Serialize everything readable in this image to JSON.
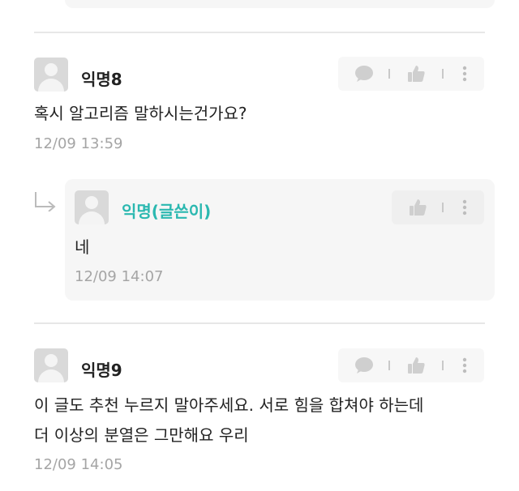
{
  "comments": [
    {
      "author": "익명8",
      "text": "혹시 알고리즘 말하시는건가요?",
      "time": "12/09 13:59"
    },
    {
      "author": "익명9",
      "text_line1": "이 글도 추천 누르지 말아주세요. 서로 힘을 합쳐야 하는데",
      "text_line2": "더 이상의 분열은 그만해요 우리",
      "time": "12/09 14:05"
    }
  ],
  "reply": {
    "author": "익명(글쓴이)",
    "text": "네",
    "time": "12/09 14:07"
  },
  "colors": {
    "author_accent": "#2bb8b0",
    "meta_gray": "#a5a5a5",
    "card_bg": "#f6f6f6"
  },
  "icons": [
    "avatar",
    "speech-bubble-icon",
    "thumbs-up-icon",
    "more-vertical-icon",
    "reply-arrow-icon"
  ]
}
